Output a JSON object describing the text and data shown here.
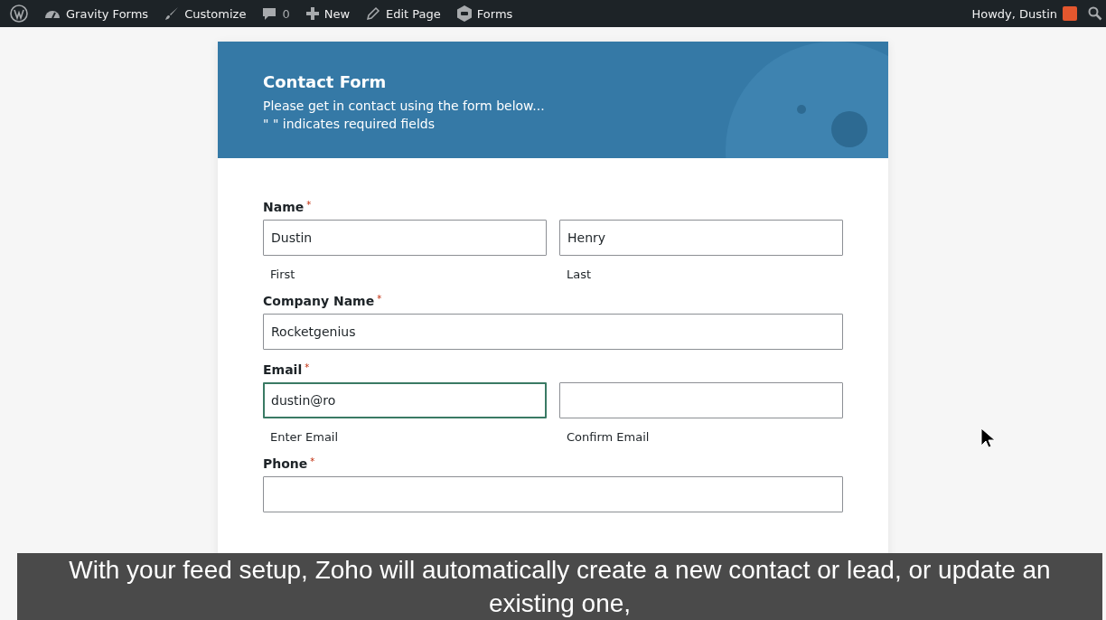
{
  "admin_bar": {
    "items": [
      {
        "kind": "logo"
      },
      {
        "kind": "site",
        "label": "Gravity Forms"
      },
      {
        "kind": "customize",
        "label": "Customize"
      },
      {
        "kind": "comments",
        "label": "0"
      },
      {
        "kind": "new",
        "label": "New"
      },
      {
        "kind": "edit",
        "label": "Edit Page"
      },
      {
        "kind": "forms",
        "label": "Forms"
      }
    ],
    "greeting": "Howdy, Dustin"
  },
  "form": {
    "title": "Contact Form",
    "description": "Please get in contact using the form below...",
    "required_note": "\" \" indicates required fields",
    "fields": [
      {
        "label": "Name",
        "required_mark": "*",
        "inputs": [
          {
            "value": "Dustin",
            "sublabel": "First",
            "focused": false
          },
          {
            "value": "Henry",
            "sublabel": "Last",
            "focused": false
          }
        ]
      },
      {
        "label": "Company Name",
        "required_mark": "*",
        "inputs": [
          {
            "value": "Rocketgenius",
            "focused": false
          }
        ]
      },
      {
        "label": "Email",
        "required_mark": "*",
        "inputs": [
          {
            "value": "dustin@ro",
            "sublabel": "Enter Email",
            "focused": true
          },
          {
            "sublabel": "Confirm Email",
            "focused": false
          }
        ]
      },
      {
        "label": "Phone",
        "required_mark": "*",
        "inputs": [
          {
            "focused": false
          }
        ]
      }
    ]
  },
  "caption": "With your feed setup, Zoho will automatically create a new contact or lead, or update an existing one,"
}
